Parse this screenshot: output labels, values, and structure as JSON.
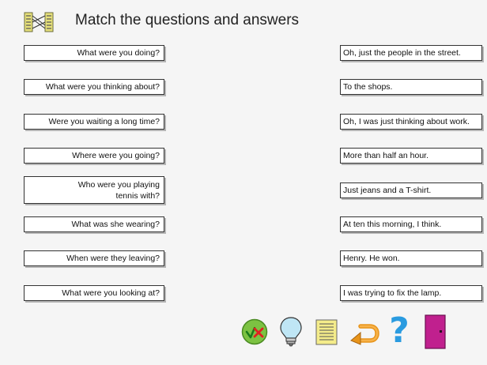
{
  "exercise": {
    "title": "Match the questions and answers"
  },
  "questions": [
    {
      "text": "What were you doing?"
    },
    {
      "text": "What were you thinking about?"
    },
    {
      "text": "Were you waiting a long time?"
    },
    {
      "text": "Where were you going?"
    },
    {
      "text": "Who were you playing tennis with?"
    },
    {
      "text": "What was she wearing?"
    },
    {
      "text": "When were they leaving?"
    },
    {
      "text": "What were you looking at?"
    }
  ],
  "answers": [
    {
      "text": "Oh, just the people in the street."
    },
    {
      "text": "To the shops."
    },
    {
      "text": "Oh, I was just thinking about work."
    },
    {
      "text": "More than half an hour."
    },
    {
      "text": "Just jeans and a T-shirt."
    },
    {
      "text": "At ten this morning, I think."
    },
    {
      "text": "Henry. He won."
    },
    {
      "text": "I was trying to fix the lamp."
    }
  ],
  "toolbar": {
    "check_icon": "check-cross-icon",
    "hint_icon": "lightbulb-icon",
    "notes_icon": "notepad-icon",
    "undo_icon": "undo-arrow-icon",
    "help_label": "?",
    "exit_icon": "door-icon"
  },
  "colors": {
    "check_fill": "#7cc242",
    "check_tick": "#1a8a1a",
    "cross": "#e02020",
    "bulb": "#bfe6f5",
    "notepad": "#f4ec8a",
    "undo": "#e8941a",
    "help": "#2a9be0",
    "door": "#c0208e"
  }
}
